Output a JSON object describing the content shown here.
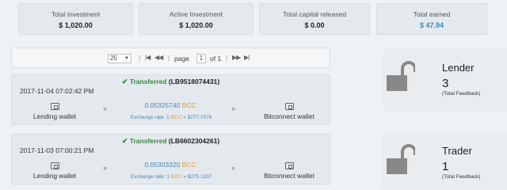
{
  "stats": [
    {
      "label": "Total investment",
      "value": "$ 1,020.00"
    },
    {
      "label": "Active Investment",
      "value": "$ 1,020.00"
    },
    {
      "label": "Total capital released",
      "value": "$ 0.00"
    },
    {
      "label": "Total earned",
      "value": "$ 47.94"
    }
  ],
  "pager": {
    "per_page": "25",
    "page_label": "page",
    "page_value": "1",
    "of_label": "of 1"
  },
  "transactions": [
    {
      "status": "Transferred",
      "id": "(LB9518074431)",
      "date": "2017-11-04 07:02:42 PM",
      "from": "Lending wallet",
      "amount": "0.05325740",
      "currency": "BCC",
      "rate_prefix": "Exchange rate: 1",
      "rate_currency": "BCC",
      "rate_value": "= $277.7079",
      "to": "Bitconnect wallet"
    },
    {
      "status": "Transferred",
      "id": "(LB6602304261)",
      "date": "2017-11-03 07:00:21 PM",
      "from": "Lending wallet",
      "amount": "0.05303320",
      "currency": "BCC",
      "rate_prefix": "Exchange rate: 1",
      "rate_currency": "BCC",
      "rate_value": "= $275.1107",
      "to": "Bitconnect wallet"
    }
  ],
  "profiles": [
    {
      "role": "Lender",
      "count": "3",
      "feedback": "(Total Feedback)"
    },
    {
      "role": "Trader",
      "count": "1",
      "feedback": "(Total Feedback)"
    }
  ],
  "colors": {
    "accent": "#3d87b8",
    "currency": "#e39b28",
    "success": "#2f8a3c",
    "lock": "#888888"
  },
  "icons": {
    "status": "check-icon",
    "wallet": "wallet-icon",
    "arrow": "double-chevron-right-icon",
    "profile": "unlock-icon"
  }
}
